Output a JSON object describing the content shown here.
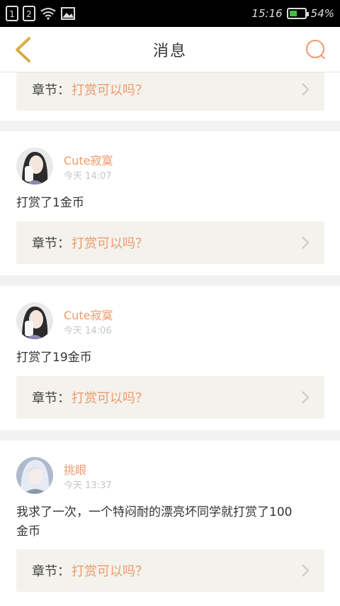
{
  "status_bar": {
    "sim1": "1",
    "sim2": "2",
    "time": "15:16",
    "battery": "54%",
    "battery_level": 0.54
  },
  "header": {
    "title": "消息",
    "back_icon": "back-chevron-icon",
    "search_icon": "search-icon",
    "accent_color": "#f0996b"
  },
  "top_card": {
    "chapter_label": "章节：",
    "chapter_name": "打赏可以吗？"
  },
  "messages": [
    {
      "user": "Cute寂寞",
      "time": "今天 14:07",
      "text": "打赏了1金币",
      "chapter_label": "章节：",
      "chapter_name": "打赏可以吗？"
    },
    {
      "user": "Cute寂寞",
      "time": "今天 14:06",
      "text": "打赏了19金币",
      "chapter_label": "章节：",
      "chapter_name": "打赏可以吗？"
    },
    {
      "user": "挑眼",
      "time": "今天 13:37",
      "text": "我求了一次，一个特闷耐的漂亮坏同学就打赏了100金币",
      "chapter_label": "章节：",
      "chapter_name": "打赏可以吗？"
    }
  ]
}
